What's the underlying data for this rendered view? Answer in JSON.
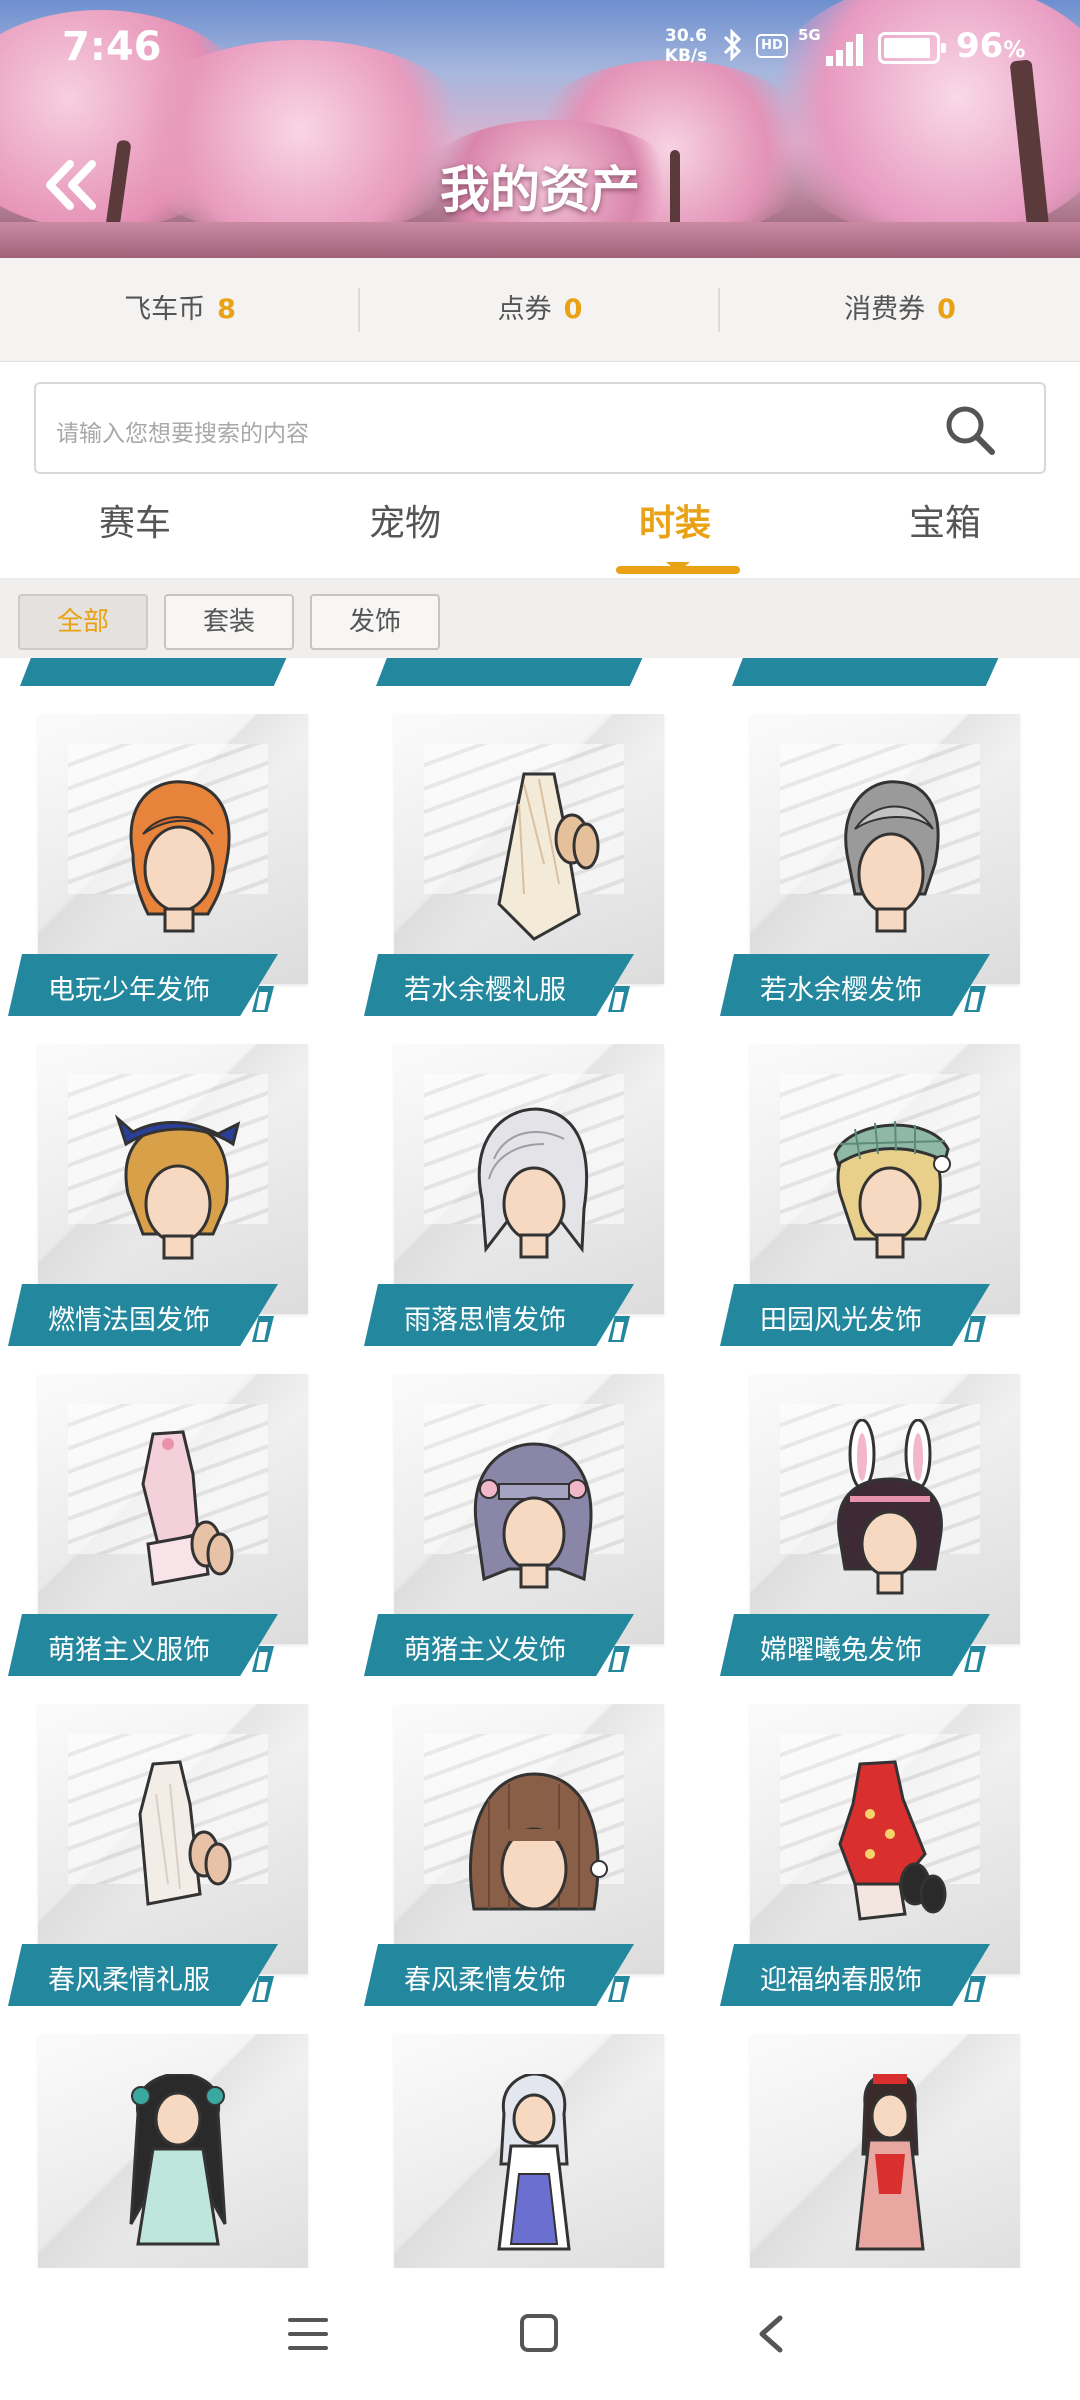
{
  "status_bar": {
    "time": "7:46",
    "net_speed": "30.6\nKB/s",
    "hd": "HD",
    "signal_label": "5G",
    "battery_percent": "96",
    "battery_unit": "%",
    "battery_level": 0.96
  },
  "header": {
    "title": "我的资产"
  },
  "currencies": [
    {
      "label": "飞车币",
      "value": "8"
    },
    {
      "label": "点券",
      "value": "0"
    },
    {
      "label": "消费券",
      "value": "0"
    }
  ],
  "search": {
    "placeholder": "请输入您想要搜索的内容"
  },
  "tabs": [
    {
      "label": "赛车",
      "active": false
    },
    {
      "label": "宠物",
      "active": false
    },
    {
      "label": "时装",
      "active": true
    },
    {
      "label": "宝箱",
      "active": false
    }
  ],
  "filters": [
    {
      "label": "全部",
      "active": true
    },
    {
      "label": "套装",
      "active": false
    },
    {
      "label": "发饰",
      "active": false
    }
  ],
  "items": [
    {
      "name": "电玩少年发饰",
      "icon": "orange-hair-accessory"
    },
    {
      "name": "若水余樱礼服",
      "icon": "sakura-dress"
    },
    {
      "name": "若水余樱发饰",
      "icon": "grey-hair-accessory"
    },
    {
      "name": "燃情法国发饰",
      "icon": "bandana-hair-accessory"
    },
    {
      "name": "雨落思情发饰",
      "icon": "silver-hair-accessory"
    },
    {
      "name": "田园风光发饰",
      "icon": "plaid-cap-hair-accessory"
    },
    {
      "name": "萌猪主义服饰",
      "icon": "pink-outfit"
    },
    {
      "name": "萌猪主义发饰",
      "icon": "lilac-hair-accessory"
    },
    {
      "name": "嫦曜曦兔发饰",
      "icon": "bunny-ears-hair-accessory"
    },
    {
      "name": "春风柔情礼服",
      "icon": "white-dress"
    },
    {
      "name": "春风柔情发饰",
      "icon": "brown-long-hair-accessory"
    },
    {
      "name": "迎福纳春服饰",
      "icon": "red-qipao-outfit"
    }
  ],
  "colors": {
    "accent": "#e8a214",
    "label_bg": "#23879e"
  }
}
